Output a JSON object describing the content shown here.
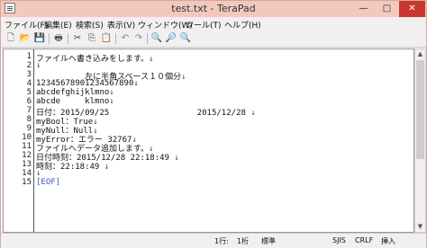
{
  "window": {
    "title": "test.txt - TeraPad",
    "minimize": "—",
    "maximize": "□",
    "close": "✕"
  },
  "menu": [
    "ファイル(F)",
    "編集(E)",
    "検索(S)",
    "表示(V)",
    "ウィンドウ(W)",
    "ツール(T)",
    "ヘルプ(H)"
  ],
  "toolbar": {
    "icons": [
      "new-file-icon",
      "open-folder-icon",
      "save-icon",
      "print-icon",
      "cut-icon",
      "copy-icon",
      "paste-icon",
      "undo-icon",
      "redo-icon",
      "find-icon",
      "find-next-icon",
      "find-prev-icon"
    ],
    "glyphs": [
      "🗋",
      "📂",
      "💾",
      "🖶",
      "✂",
      "⎘",
      "📋",
      "↶",
      "↷",
      "🔍",
      "🔎",
      "🔍"
    ]
  },
  "editor": {
    "line_numbers": [
      "1",
      "2",
      "3",
      "4",
      "5",
      "6",
      "7",
      "8",
      "9",
      "10",
      "11",
      "12",
      "13",
      "14",
      "15"
    ],
    "lines": [
      {
        "text": "ファイルへ書き込みをします。",
        "mark": "↓"
      },
      {
        "text": "",
        "mark": "↓"
      },
      {
        "text": "          左に半角スペース１０個分",
        "mark": "↓"
      },
      {
        "text": "12345678901234567890",
        "mark": "↓"
      },
      {
        "text": "abcdefghijklmno",
        "mark": "↓"
      },
      {
        "text": "abcde     klmno",
        "mark": "↓"
      },
      {
        "text": "日付：2015/09/25                  2015/12/28 ",
        "mark": "↓"
      },
      {
        "text": "myBool：True",
        "mark": "↓"
      },
      {
        "text": "myNull：Null",
        "mark": "↓"
      },
      {
        "text": "myError：エラー 32767",
        "mark": "↓"
      },
      {
        "text": "ファイルへデータ追加します。",
        "mark": "↓"
      },
      {
        "text": "日付時刻：2015/12/28 22:18:49 ",
        "mark": "↓"
      },
      {
        "text": "時刻：22:18:49 ",
        "mark": "↓"
      },
      {
        "text": "",
        "mark": "↓"
      },
      {
        "text": "[EOF]",
        "mark": ""
      }
    ]
  },
  "status": {
    "line": "1行:",
    "col": "1桁",
    "mode": "標準",
    "encoding": "SJIS",
    "newline": "CRLF",
    "insert": "挿入"
  }
}
